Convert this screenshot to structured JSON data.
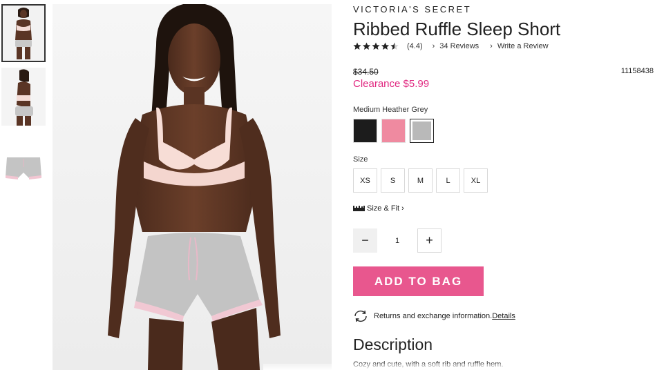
{
  "gallery": {
    "thumbnails": [
      {
        "alt": "model front view"
      },
      {
        "alt": "model side view"
      },
      {
        "alt": "product flat view"
      }
    ],
    "selected_index": 0
  },
  "product": {
    "brand": "VICTORIA'S SECRET",
    "title": "Ribbed Ruffle Sleep Short",
    "rating_value": "(4.4)",
    "rating": 4.4,
    "reviews_link": "34 Reviews",
    "write_review_link": "Write a Review",
    "original_price": "$34.50",
    "sale_price": "Clearance $5.99",
    "sku": "11158438",
    "color_label": "Medium Heather Grey",
    "swatches": [
      {
        "name": "black",
        "color": "#1c1c1c"
      },
      {
        "name": "pink",
        "color": "#ef8aa0"
      },
      {
        "name": "medium-heather-grey",
        "color": "#b9b9b9",
        "selected": true
      }
    ],
    "size_label": "Size",
    "sizes": [
      "XS",
      "S",
      "M",
      "L",
      "XL"
    ],
    "size_fit_link": "Size & Fit",
    "quantity": "1",
    "add_to_bag": "ADD TO BAG",
    "returns_text": "Returns and exchange information.",
    "returns_link": "Details",
    "description_title": "Description",
    "description_text": "Cozy and cute, with a soft rib and ruffle hem."
  },
  "colors": {
    "accent": "#e8578e",
    "clearance": "#e0267f"
  },
  "icons": {
    "minus": "−",
    "plus": "+",
    "chevron": "›"
  }
}
